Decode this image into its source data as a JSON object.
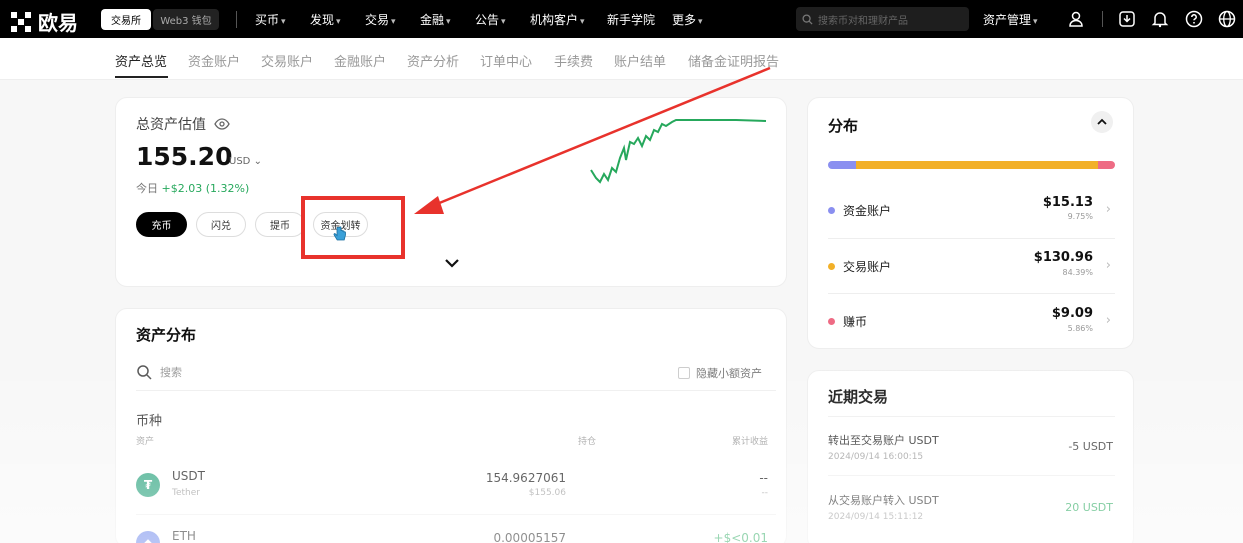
{
  "header": {
    "logo_text": "欧易",
    "mode_pills": [
      "交易所",
      "Web3 钱包"
    ],
    "nav": [
      "买币",
      "发现",
      "交易",
      "金融",
      "公告",
      "机构客户",
      "新手学院",
      "更多"
    ],
    "search_placeholder": "搜索币对和理财产品",
    "asset_mgmt": "资产管理"
  },
  "subnav": {
    "tabs": [
      "资产总览",
      "资金账户",
      "交易账户",
      "金融账户",
      "资产分析",
      "订单中心",
      "手续费",
      "账户结单",
      "储备金证明报告"
    ],
    "active_index": 0
  },
  "overview": {
    "title": "总资产估值",
    "value": "155.20",
    "unit": "USD",
    "today_label": "今日",
    "today_change": "+$2.03 (1.32%)",
    "buttons": [
      "充币",
      "闪兑",
      "提币",
      "资金划转"
    ]
  },
  "distribution_section": {
    "title": "资产分布",
    "search_placeholder": "搜索",
    "hide_small_label": "隐藏小额资产",
    "section_label": "币种",
    "col_asset": "资产",
    "col_holding": "持仓",
    "col_pnl": "累计收益",
    "rows": [
      {
        "symbol": "USDT",
        "name": "Tether",
        "holding": "154.9627061",
        "holding_usd": "$155.06",
        "pnl": "--",
        "pnl_sub": "--"
      },
      {
        "symbol": "ETH",
        "name": "",
        "holding": "0.00005157",
        "holding_usd": "",
        "pnl": "+$<0.01",
        "pnl_sub": ""
      }
    ]
  },
  "pie": {
    "title": "分布",
    "accounts": [
      {
        "name": "资金账户",
        "value": "$15.13",
        "pct": "9.75%",
        "color": "#8a8ff0",
        "share": 0.0975
      },
      {
        "name": "交易账户",
        "value": "$130.96",
        "pct": "84.39%",
        "color": "#f2b028",
        "share": 0.8439
      },
      {
        "name": "赚币",
        "value": "$9.09",
        "pct": "5.86%",
        "color": "#ee6b84",
        "share": 0.0586
      }
    ]
  },
  "recent": {
    "title": "近期交易",
    "items": [
      {
        "title": "转出至交易账户 USDT",
        "time": "2024/09/14 16:00:15",
        "amount": "-5 USDT",
        "positive": false
      },
      {
        "title": "从交易账户转入 USDT",
        "time": "2024/09/14 15:11:12",
        "amount": "20 USDT",
        "positive": true
      }
    ]
  },
  "colors": {
    "up": "#26a85c",
    "annotation": "#e8322c"
  }
}
